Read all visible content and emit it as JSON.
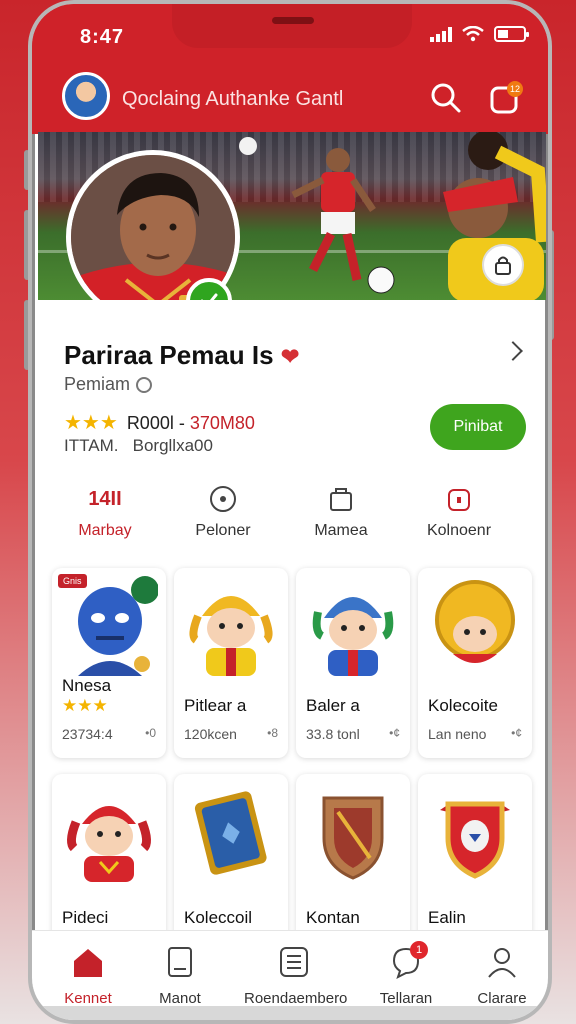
{
  "status": {
    "time": "8:47"
  },
  "header": {
    "title": "Qoclaing Authanke Gantl",
    "notification_count": "12"
  },
  "profile": {
    "name": "Pariraa Pemau Is",
    "role": "Pemiam",
    "stars": "★★★",
    "price_label": "R000l -",
    "price_value": "370M80",
    "team_label": "ITTAM.",
    "team_value": "Borgllxa00",
    "action_label": "Pinibat"
  },
  "tabs": [
    {
      "label": "Marbay",
      "value": "14II"
    },
    {
      "label": "Peloner"
    },
    {
      "label": "Mamea"
    },
    {
      "label": "Kolnoenr"
    }
  ],
  "cards": [
    {
      "name": "Nnesa",
      "stars": "★★★",
      "sub": "23734:4",
      "meta": "•0",
      "tag": "Gnis"
    },
    {
      "name": "Pitlear a",
      "sub": "120kcen",
      "meta": "•8"
    },
    {
      "name": "Baler a",
      "sub": "33.8 tonl",
      "meta": "•¢"
    },
    {
      "name": "Kolecoite",
      "sub": "Lan neno",
      "meta": "•¢"
    },
    {
      "name": "Pideci"
    },
    {
      "name": "Koleccoil"
    },
    {
      "name": "Kontan"
    },
    {
      "name": "Ealin"
    }
  ],
  "nav": [
    {
      "label": "Kennet"
    },
    {
      "label": "Manot"
    },
    {
      "label": "Roendaembero"
    },
    {
      "label": "Tellaran",
      "badge": "1"
    },
    {
      "label": "Clarare"
    }
  ],
  "colors": {
    "primary": "#cf2229",
    "accent_green": "#3fa51e",
    "star": "#f4b400"
  }
}
